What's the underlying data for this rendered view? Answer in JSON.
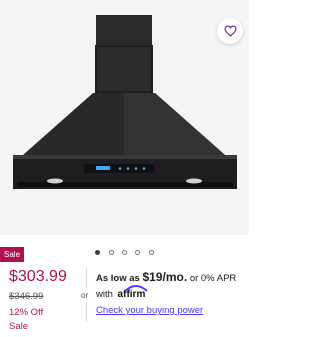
{
  "product": {
    "image_alt": "Black wall-mount chimney range hood",
    "favorite_icon": "heart-outline-icon",
    "badge": "Sale",
    "carousel": {
      "total": 5,
      "active_index": 0
    }
  },
  "pricing": {
    "price": "$303.99",
    "was_price": "$346.99",
    "discount": "12% Off",
    "sale_label": "Sale"
  },
  "financing": {
    "or": "or",
    "prefix": "As low as",
    "monthly": "$19/mo.",
    "suffix": "or 0% APR",
    "with": "with",
    "provider": "affirm",
    "link": "Check your buying power"
  },
  "colors": {
    "accent": "#b0124f",
    "link": "#4a3aff",
    "image_bg": "#f5f5f6"
  }
}
